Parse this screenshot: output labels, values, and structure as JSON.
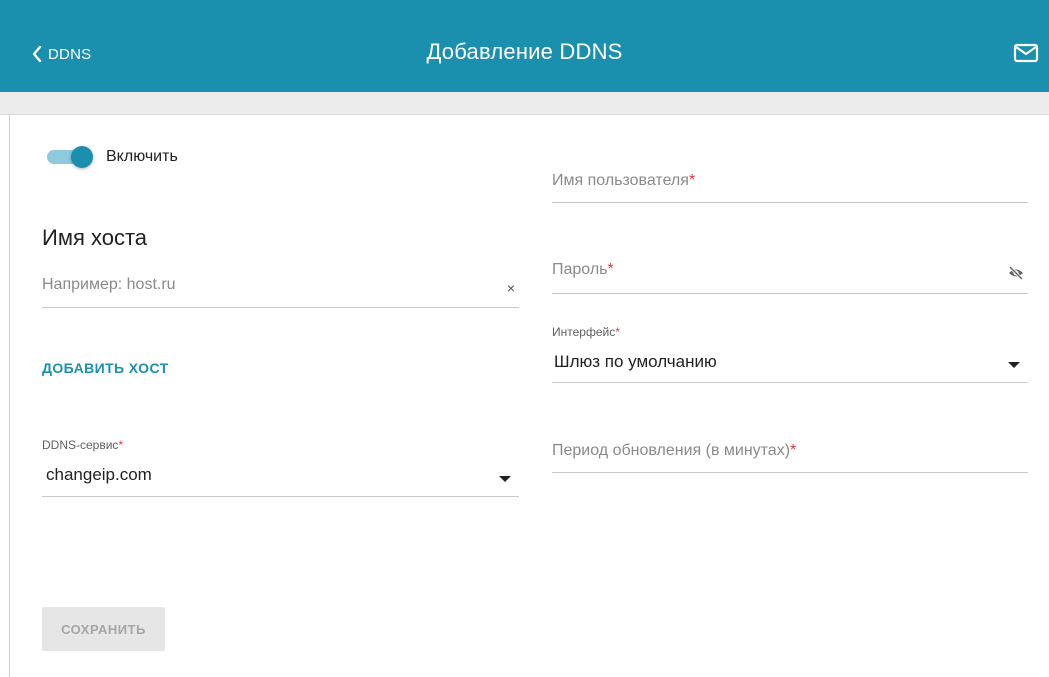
{
  "header": {
    "back_label": "DDNS",
    "title": "Добавление DDNS",
    "icons": {
      "back": "chevron-left-icon",
      "mail": "mail-icon"
    },
    "colors": {
      "accent": "#1a8fae"
    }
  },
  "form": {
    "enable": {
      "label": "Включить",
      "checked": true
    },
    "hostname_section": "Имя хоста",
    "host_input": {
      "placeholder": "Например: host.ru",
      "value": "",
      "clear_symbol": "×"
    },
    "add_host_label": "ДОБАВИТЬ ХОСТ",
    "ddns_service": {
      "label": "DDNS-сервис",
      "required_mark": "*",
      "value": "changeip.com"
    },
    "username": {
      "placeholder": "Имя пользователя",
      "required_mark": "*"
    },
    "password": {
      "placeholder": "Пароль",
      "required_mark": "*",
      "icon": "eye-off-icon"
    },
    "interface": {
      "label": "Интерфейс",
      "required_mark": "*",
      "value": "Шлюз по умолчанию"
    },
    "update_period": {
      "placeholder": "Период обновления (в минутах)",
      "required_mark": "*"
    },
    "save_label": "СОХРАНИТЬ"
  }
}
